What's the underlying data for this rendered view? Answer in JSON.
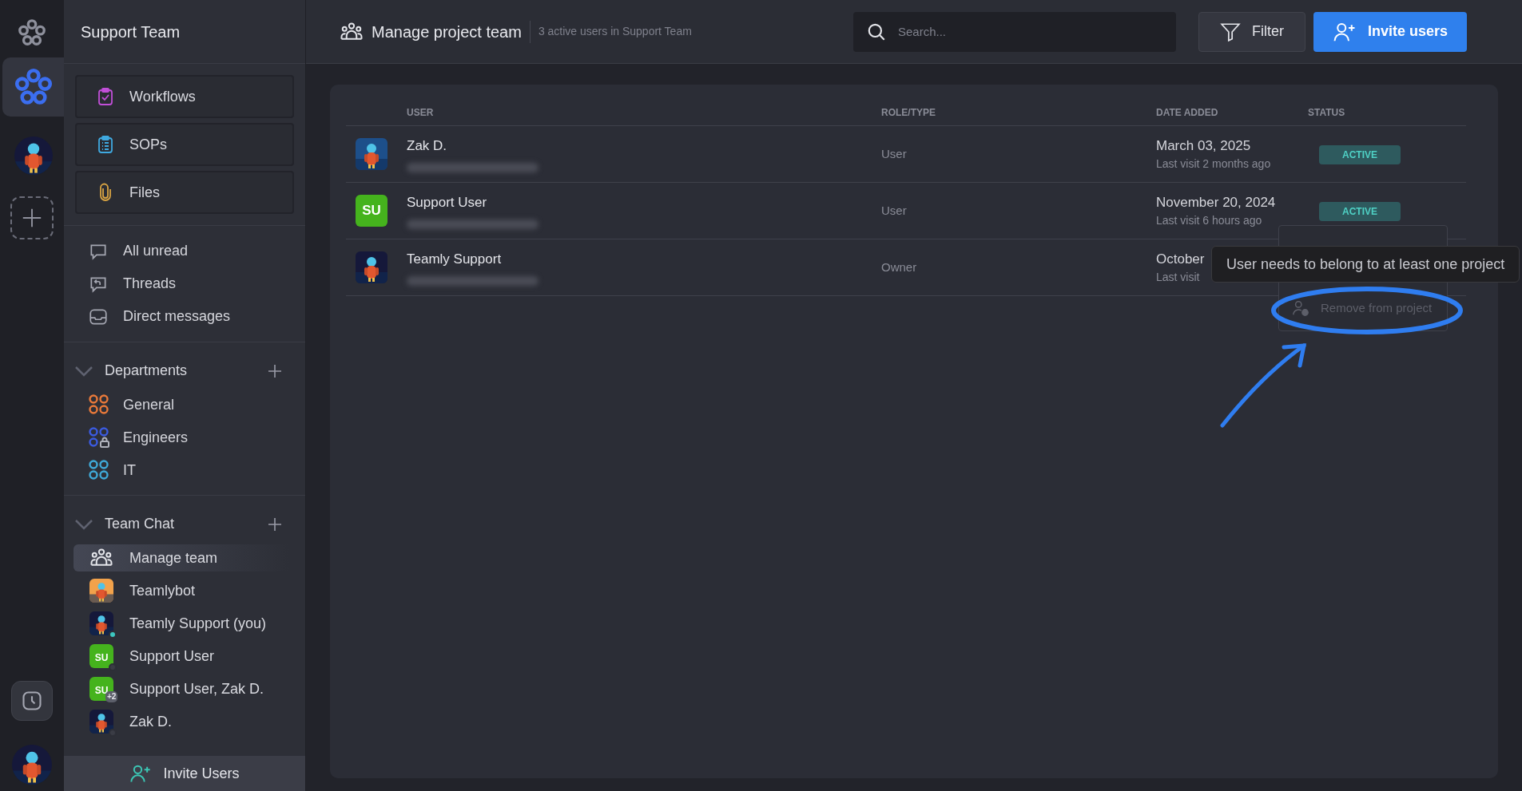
{
  "rail": {
    "workspaces": [
      {
        "kind": "logo",
        "selected": true
      },
      {
        "kind": "picture",
        "selected": false
      }
    ]
  },
  "sidebar": {
    "title": "Support Team",
    "nav_cards": [
      {
        "label": "Workflows",
        "color": "#c14fd8"
      },
      {
        "label": "SOPs",
        "color": "#3fa9e0"
      },
      {
        "label": "Files",
        "color": "#d9a443"
      }
    ],
    "inbox": [
      {
        "label": "All unread"
      },
      {
        "label": "Threads"
      },
      {
        "label": "Direct messages"
      }
    ],
    "sections": [
      {
        "title": "Departments",
        "expanded": true,
        "items": [
          {
            "label": "General",
            "color": "#e8793a",
            "locked": false
          },
          {
            "label": "Engineers",
            "color": "#3b5be0",
            "locked": true
          },
          {
            "label": "IT",
            "color": "#3fa9d8",
            "locked": false
          }
        ]
      },
      {
        "title": "Team Chat",
        "expanded": true,
        "chats": [
          {
            "kind": "icon",
            "label": "Manage team",
            "selected": true
          },
          {
            "kind": "picture",
            "label": "Teamlybot",
            "selected": false
          },
          {
            "kind": "picture",
            "label": "Teamly Support (you)",
            "selected": false,
            "color": "#3cc7c0"
          },
          {
            "kind": "initials",
            "initials": "SU",
            "label": "Support User",
            "selected": false,
            "color": "#3a3c45"
          },
          {
            "kind": "group",
            "initials": "SU",
            "extra": "+2",
            "label": "Support User, Zak D.",
            "selected": false
          },
          {
            "kind": "picture",
            "label": "Zak D.",
            "selected": false,
            "color": "#3a3c45"
          }
        ]
      }
    ],
    "footer_button": "Invite Users"
  },
  "header": {
    "title": "Manage project team",
    "subtitle": "3 active users in Support Team",
    "search": {
      "placeholder": "Search..."
    },
    "buttons": [
      {
        "kind": "secondary",
        "label": "Filter"
      },
      {
        "kind": "primary",
        "label": "Invite users"
      }
    ]
  },
  "table": {
    "columns": [
      "USER",
      "ROLE/TYPE",
      "DATE ADDED",
      "STATUS"
    ],
    "rows": [
      {
        "kind": "picture",
        "name": "Zak D.",
        "role": "User",
        "date": "March 03, 2025",
        "last_visit": "Last visit 2 months ago",
        "status": "ACTIVE"
      },
      {
        "kind": "initials",
        "initials": "SU",
        "name": "Support User",
        "role": "User",
        "date": "November 20, 2024",
        "last_visit": "Last visit 6 hours ago",
        "status": "ACTIVE"
      },
      {
        "kind": "picture",
        "name": "Teamly Support",
        "role": "Owner",
        "date": "October",
        "last_visit": "Last visit"
      }
    ]
  },
  "context_menu": {
    "items": [
      {
        "label": "Remove from project",
        "disabled": true
      }
    ]
  },
  "tooltip": "User needs to belong to at least one project"
}
